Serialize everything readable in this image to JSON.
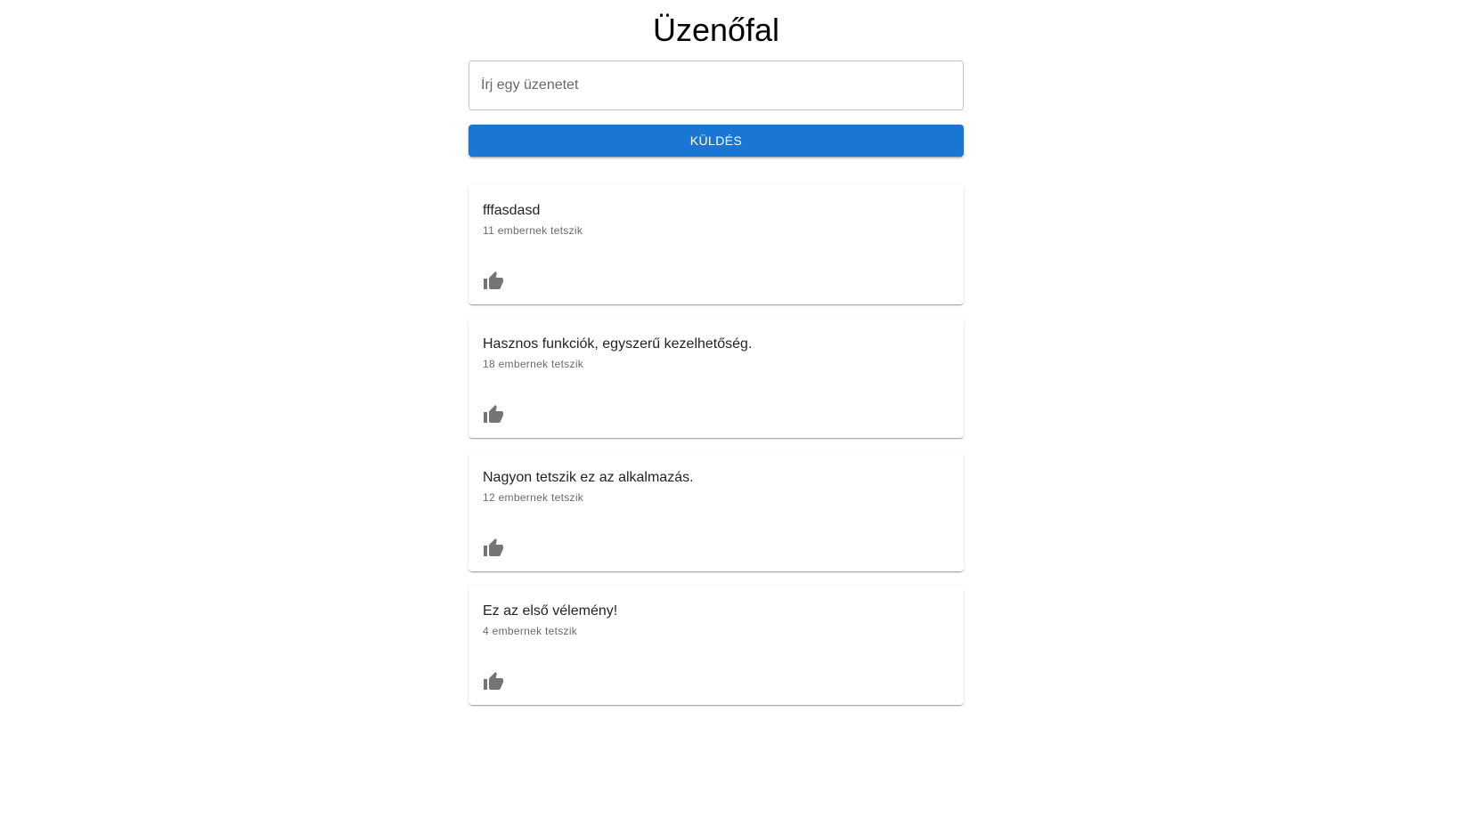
{
  "page": {
    "title": "Üzenőfal"
  },
  "form": {
    "input_placeholder": "Írj egy üzenetet",
    "input_value": "",
    "send_label": "Küldés"
  },
  "colors": {
    "primary": "#1976d2",
    "icon": "#757575"
  },
  "messages": [
    {
      "text": "fffasdasd",
      "likes": "11 embernek tetszik",
      "icon": "thumb-up-icon"
    },
    {
      "text": "Hasznos funkciók, egyszerű kezelhetőség.",
      "likes": "18 embernek tetszik",
      "icon": "thumb-up-icon"
    },
    {
      "text": "Nagyon tetszik ez az alkalmazás.",
      "likes": "12 embernek tetszik",
      "icon": "thumb-up-icon"
    },
    {
      "text": "Ez az első vélemény!",
      "likes": "4 embernek tetszik",
      "icon": "thumb-up-icon"
    }
  ]
}
